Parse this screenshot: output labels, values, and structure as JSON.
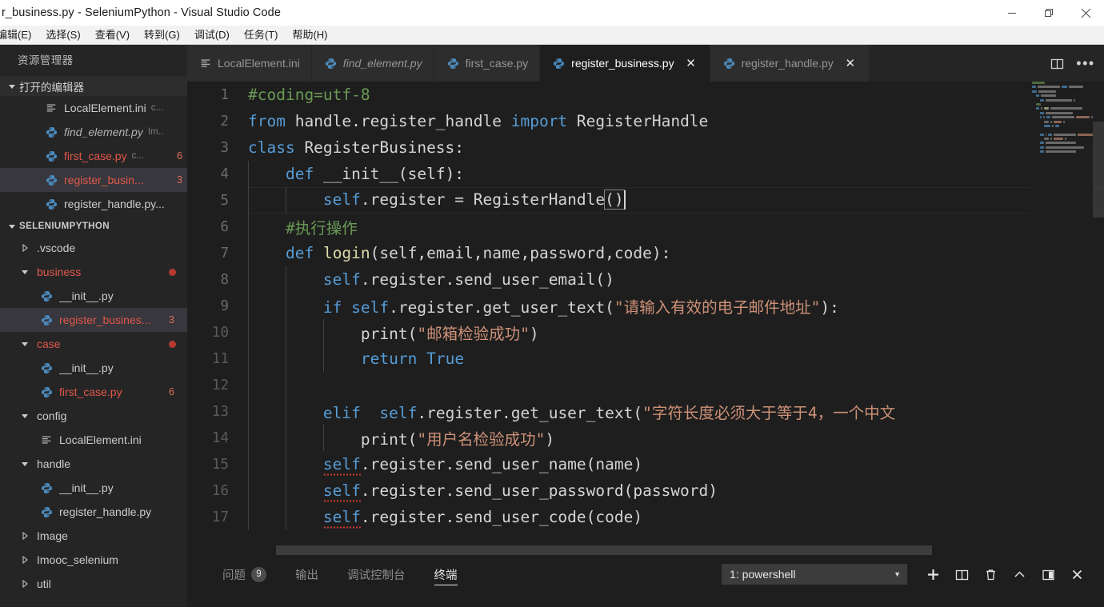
{
  "window": {
    "title": "r_business.py - SeleniumPython - Visual Studio Code",
    "controls": {
      "minimize": "minimize-icon",
      "restore": "restore-icon",
      "close": "close-icon"
    }
  },
  "menubar": {
    "items": [
      {
        "label": "编辑(E)"
      },
      {
        "label": "选择(S)"
      },
      {
        "label": "查看(V)"
      },
      {
        "label": "转到(G)"
      },
      {
        "label": "调试(D)"
      },
      {
        "label": "任务(T)"
      },
      {
        "label": "帮助(H)"
      }
    ]
  },
  "sidebar": {
    "title": "资源管理器",
    "open_editors": {
      "label": "打开的编辑器",
      "items": [
        {
          "name": "LocalElement.ini",
          "icon": "ini-file-icon",
          "desc": "c...",
          "badge": "",
          "modified": false,
          "italic": false,
          "selected": false
        },
        {
          "name": "find_element.py",
          "icon": "python-file-icon",
          "desc": "Im..",
          "badge": "",
          "modified": false,
          "italic": true,
          "selected": false
        },
        {
          "name": "first_case.py",
          "icon": "python-file-icon",
          "desc": "c...",
          "badge": "6",
          "modified": true,
          "italic": false,
          "selected": false
        },
        {
          "name": "register_busin...",
          "icon": "python-file-icon",
          "desc": "",
          "badge": "3",
          "modified": true,
          "italic": false,
          "selected": true
        },
        {
          "name": "register_handle.py...",
          "icon": "python-file-icon",
          "desc": "",
          "badge": "",
          "modified": false,
          "italic": false,
          "selected": false
        }
      ]
    },
    "project": {
      "label": "SELENIUMPYTHON",
      "items": [
        {
          "name": ".vscode",
          "type": "folder",
          "expanded": false,
          "indent": 1,
          "modified": false,
          "badge": "",
          "dot": false,
          "selected": false
        },
        {
          "name": "business",
          "type": "folder",
          "expanded": true,
          "indent": 1,
          "modified": true,
          "badge": "",
          "dot": true,
          "selected": false
        },
        {
          "name": "__init__.py",
          "type": "python",
          "indent": 2,
          "modified": false,
          "badge": "",
          "dot": false,
          "selected": false
        },
        {
          "name": "register_busines...",
          "type": "python",
          "indent": 2,
          "modified": true,
          "badge": "3",
          "dot": false,
          "selected": true
        },
        {
          "name": "case",
          "type": "folder",
          "expanded": true,
          "indent": 1,
          "modified": true,
          "badge": "",
          "dot": true,
          "selected": false
        },
        {
          "name": "__init__.py",
          "type": "python",
          "indent": 2,
          "modified": false,
          "badge": "",
          "dot": false,
          "selected": false
        },
        {
          "name": "first_case.py",
          "type": "python",
          "indent": 2,
          "modified": true,
          "badge": "6",
          "dot": false,
          "selected": false
        },
        {
          "name": "config",
          "type": "folder",
          "expanded": true,
          "indent": 1,
          "modified": false,
          "badge": "",
          "dot": false,
          "selected": false
        },
        {
          "name": "LocalElement.ini",
          "type": "ini",
          "indent": 2,
          "modified": false,
          "badge": "",
          "dot": false,
          "selected": false
        },
        {
          "name": "handle",
          "type": "folder",
          "expanded": true,
          "indent": 1,
          "modified": false,
          "badge": "",
          "dot": false,
          "selected": false
        },
        {
          "name": "__init__.py",
          "type": "python",
          "indent": 2,
          "modified": false,
          "badge": "",
          "dot": false,
          "selected": false
        },
        {
          "name": "register_handle.py",
          "type": "python",
          "indent": 2,
          "modified": false,
          "badge": "",
          "dot": false,
          "selected": false
        },
        {
          "name": "Image",
          "type": "folder",
          "expanded": false,
          "indent": 1,
          "modified": false,
          "badge": "",
          "dot": false,
          "selected": false
        },
        {
          "name": "Imooc_selenium",
          "type": "folder",
          "expanded": false,
          "indent": 1,
          "modified": false,
          "badge": "",
          "dot": false,
          "selected": false
        },
        {
          "name": "util",
          "type": "folder",
          "expanded": false,
          "indent": 1,
          "modified": false,
          "badge": "",
          "dot": false,
          "selected": false
        }
      ]
    }
  },
  "tabs": {
    "items": [
      {
        "label": "LocalElement.ini",
        "icon": "ini-file-icon",
        "active": false,
        "italic": false,
        "closable": false
      },
      {
        "label": "find_element.py",
        "icon": "python-file-icon",
        "active": false,
        "italic": true,
        "closable": false
      },
      {
        "label": "first_case.py",
        "icon": "python-file-icon",
        "active": false,
        "italic": false,
        "closable": false
      },
      {
        "label": "register_business.py",
        "icon": "python-file-icon",
        "active": true,
        "italic": false,
        "closable": true
      },
      {
        "label": "register_handle.py",
        "icon": "python-file-icon",
        "active": false,
        "italic": false,
        "closable": true
      }
    ],
    "close_glyph": "✕",
    "actions": [
      {
        "name": "split-editor-icon"
      },
      {
        "name": "more-actions-icon",
        "glyph": "•••"
      }
    ]
  },
  "editor": {
    "language": "python",
    "lines": [
      {
        "num": "1",
        "tokens": [
          {
            "t": "#coding=utf-8",
            "c": "com"
          }
        ],
        "indent_guides": 0
      },
      {
        "num": "2",
        "tokens": [
          {
            "t": "from",
            "c": "kw"
          },
          {
            "t": " handle.register_handle ",
            "c": "pln"
          },
          {
            "t": "import",
            "c": "kw"
          },
          {
            "t": " RegisterHandle",
            "c": "pln"
          }
        ],
        "indent_guides": 0
      },
      {
        "num": "3",
        "tokens": [
          {
            "t": "class",
            "c": "kw"
          },
          {
            "t": " RegisterBusiness:",
            "c": "pln"
          }
        ],
        "indent_guides": 0
      },
      {
        "num": "4",
        "tokens": [
          {
            "t": "    ",
            "c": "pln"
          },
          {
            "t": "def",
            "c": "kw"
          },
          {
            "t": " __init__(self):",
            "c": "pln"
          }
        ],
        "indent_guides": 1
      },
      {
        "num": "5",
        "tokens": [
          {
            "t": "        ",
            "c": "pln"
          },
          {
            "t": "self",
            "c": "self"
          },
          {
            "t": ".register = RegisterHandle",
            "c": "pln"
          },
          {
            "t": "()",
            "c": "bracket"
          }
        ],
        "indent_guides": 2,
        "current": true,
        "caret": true
      },
      {
        "num": "6",
        "tokens": [
          {
            "t": "    ",
            "c": "pln"
          },
          {
            "t": "#执行操作",
            "c": "com"
          }
        ],
        "indent_guides": 1
      },
      {
        "num": "7",
        "tokens": [
          {
            "t": "    ",
            "c": "pln"
          },
          {
            "t": "def",
            "c": "kw"
          },
          {
            "t": " ",
            "c": "pln"
          },
          {
            "t": "login",
            "c": "fn"
          },
          {
            "t": "(self,email,name,password,code):",
            "c": "pln"
          }
        ],
        "indent_guides": 1
      },
      {
        "num": "8",
        "tokens": [
          {
            "t": "        ",
            "c": "pln"
          },
          {
            "t": "self",
            "c": "self"
          },
          {
            "t": ".register.send_user_email()",
            "c": "pln"
          }
        ],
        "indent_guides": 2
      },
      {
        "num": "9",
        "tokens": [
          {
            "t": "        ",
            "c": "pln"
          },
          {
            "t": "if",
            "c": "kw"
          },
          {
            "t": " ",
            "c": "pln"
          },
          {
            "t": "self",
            "c": "self"
          },
          {
            "t": ".register.get_user_text(",
            "c": "pln"
          },
          {
            "t": "\"请输入有效的电子邮件地址\"",
            "c": "str"
          },
          {
            "t": "):",
            "c": "pln"
          }
        ],
        "indent_guides": 2
      },
      {
        "num": "10",
        "tokens": [
          {
            "t": "            ",
            "c": "pln"
          },
          {
            "t": "print",
            "c": "pln"
          },
          {
            "t": "(",
            "c": "pln"
          },
          {
            "t": "\"邮箱检验成功\"",
            "c": "str"
          },
          {
            "t": ")",
            "c": "pln"
          }
        ],
        "indent_guides": 3,
        "dimnum": true
      },
      {
        "num": "11",
        "tokens": [
          {
            "t": "            ",
            "c": "pln"
          },
          {
            "t": "return",
            "c": "kw"
          },
          {
            "t": " ",
            "c": "pln"
          },
          {
            "t": "True",
            "c": "kw"
          }
        ],
        "indent_guides": 3,
        "dimnum": true
      },
      {
        "num": "12",
        "tokens": [],
        "indent_guides": 2,
        "dimnum": true
      },
      {
        "num": "13",
        "tokens": [
          {
            "t": "        ",
            "c": "pln"
          },
          {
            "t": "elif",
            "c": "kw"
          },
          {
            "t": "  ",
            "c": "pln"
          },
          {
            "t": "self",
            "c": "self"
          },
          {
            "t": ".register.get_user_text(",
            "c": "pln"
          },
          {
            "t": "\"字符长度必须大于等于4，一个中文",
            "c": "str"
          }
        ],
        "indent_guides": 2,
        "dimnum": true,
        "clipped": true
      },
      {
        "num": "14",
        "tokens": [
          {
            "t": "            ",
            "c": "pln"
          },
          {
            "t": "print",
            "c": "pln"
          },
          {
            "t": "(",
            "c": "pln"
          },
          {
            "t": "\"用户名检验成功\"",
            "c": "str"
          },
          {
            "t": ")",
            "c": "pln"
          }
        ],
        "indent_guides": 3,
        "dimnum": true
      },
      {
        "num": "15",
        "tokens": [
          {
            "t": "        ",
            "c": "pln"
          },
          {
            "t": "self",
            "c": "self",
            "squiggle": true
          },
          {
            "t": ".register.send_user_name(name)",
            "c": "pln"
          }
        ],
        "indent_guides": 2,
        "dimnum": true
      },
      {
        "num": "16",
        "tokens": [
          {
            "t": "        ",
            "c": "pln"
          },
          {
            "t": "self",
            "c": "self",
            "squiggle": true
          },
          {
            "t": ".register.send_user_password(password)",
            "c": "pln"
          }
        ],
        "indent_guides": 2,
        "dimnum": true
      },
      {
        "num": "17",
        "tokens": [
          {
            "t": "        ",
            "c": "pln"
          },
          {
            "t": "self",
            "c": "self",
            "squiggle": true
          },
          {
            "t": ".register.send_user_code(code)",
            "c": "pln"
          }
        ],
        "indent_guides": 2,
        "dimnum": true
      }
    ],
    "colors": {
      "background": "#1e1e1e",
      "comment": "#6a9955",
      "keyword": "#569cd6",
      "string": "#ce9178",
      "function": "#dcdcaa",
      "plain": "#d4d4d4",
      "line_number": "#6a6a6a",
      "error_squiggle": "#c03b2b"
    }
  },
  "panel": {
    "tabs": [
      {
        "label": "问题",
        "badge": "9",
        "active": false
      },
      {
        "label": "输出",
        "badge": "",
        "active": false
      },
      {
        "label": "调试控制台",
        "badge": "",
        "active": false
      },
      {
        "label": "终端",
        "badge": "",
        "active": true
      }
    ],
    "terminal_select": {
      "value": "1: powershell",
      "arrow": "▼"
    },
    "actions": [
      {
        "name": "new-terminal-icon",
        "glyph": "+"
      },
      {
        "name": "split-terminal-icon",
        "glyph": "split"
      },
      {
        "name": "kill-terminal-icon",
        "glyph": "trash"
      },
      {
        "name": "maximize-panel-icon",
        "glyph": "^"
      },
      {
        "name": "toggle-panel-icon",
        "glyph": "panel"
      },
      {
        "name": "close-panel-icon",
        "glyph": "✕"
      }
    ]
  }
}
